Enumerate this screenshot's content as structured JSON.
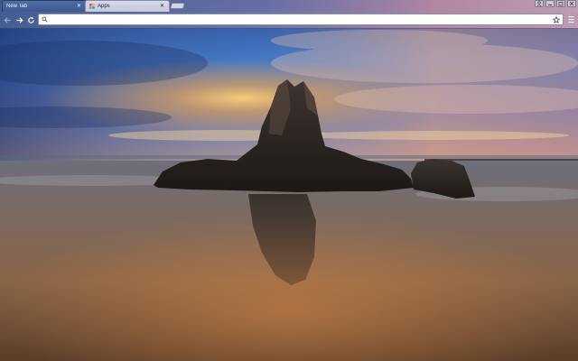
{
  "tabs": [
    {
      "title": "New Tab",
      "active": true,
      "close_icon": "close-icon"
    },
    {
      "title": "Apps",
      "active": false,
      "favicon": "apps-icon",
      "close_icon": "close-icon"
    }
  ],
  "toolbar": {
    "back_icon": "back-arrow-icon",
    "forward_icon": "forward-arrow-icon",
    "reload_icon": "reload-icon",
    "omnibox": {
      "value": "",
      "search_icon": "search-icon",
      "bookmark_icon": "star-icon"
    },
    "menu_icon": "menu-icon"
  },
  "window_controls": [
    "user-icon",
    "minimize-icon",
    "restore-icon",
    "close-icon"
  ],
  "background": {
    "description_icon": "sea-stack-sunset-wallpaper"
  },
  "colors": {
    "tab_active": "#4f6fa6",
    "omnibox_bg": "#ffffff",
    "sky_orange": "#f4a64a",
    "sky_blue": "#3a78c8",
    "water_brown": "#6b4a33"
  }
}
